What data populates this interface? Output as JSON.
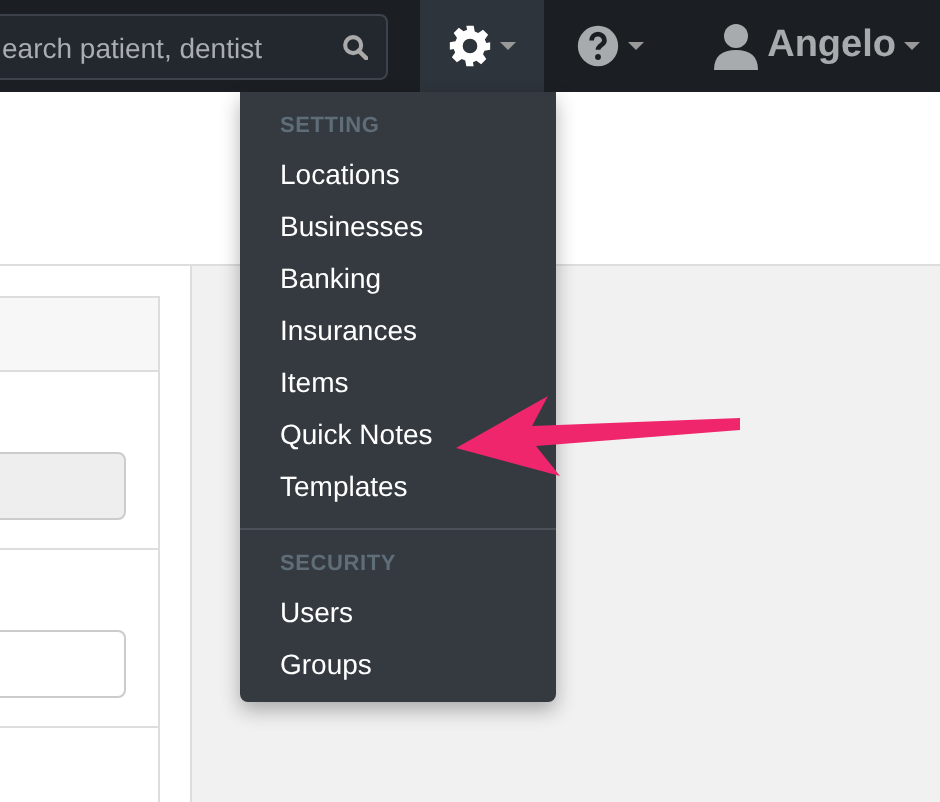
{
  "navbar": {
    "search": {
      "placeholder": "earch patient, dentist"
    },
    "settings_menu": {
      "expanded": true
    },
    "user": {
      "name": "Angelo"
    }
  },
  "settings_dropdown": {
    "sections": [
      {
        "header": "SETTING",
        "items": [
          "Locations",
          "Businesses",
          "Banking",
          "Insurances",
          "Items",
          "Quick Notes",
          "Templates"
        ]
      },
      {
        "header": "SECURITY",
        "items": [
          "Users",
          "Groups"
        ]
      }
    ]
  }
}
